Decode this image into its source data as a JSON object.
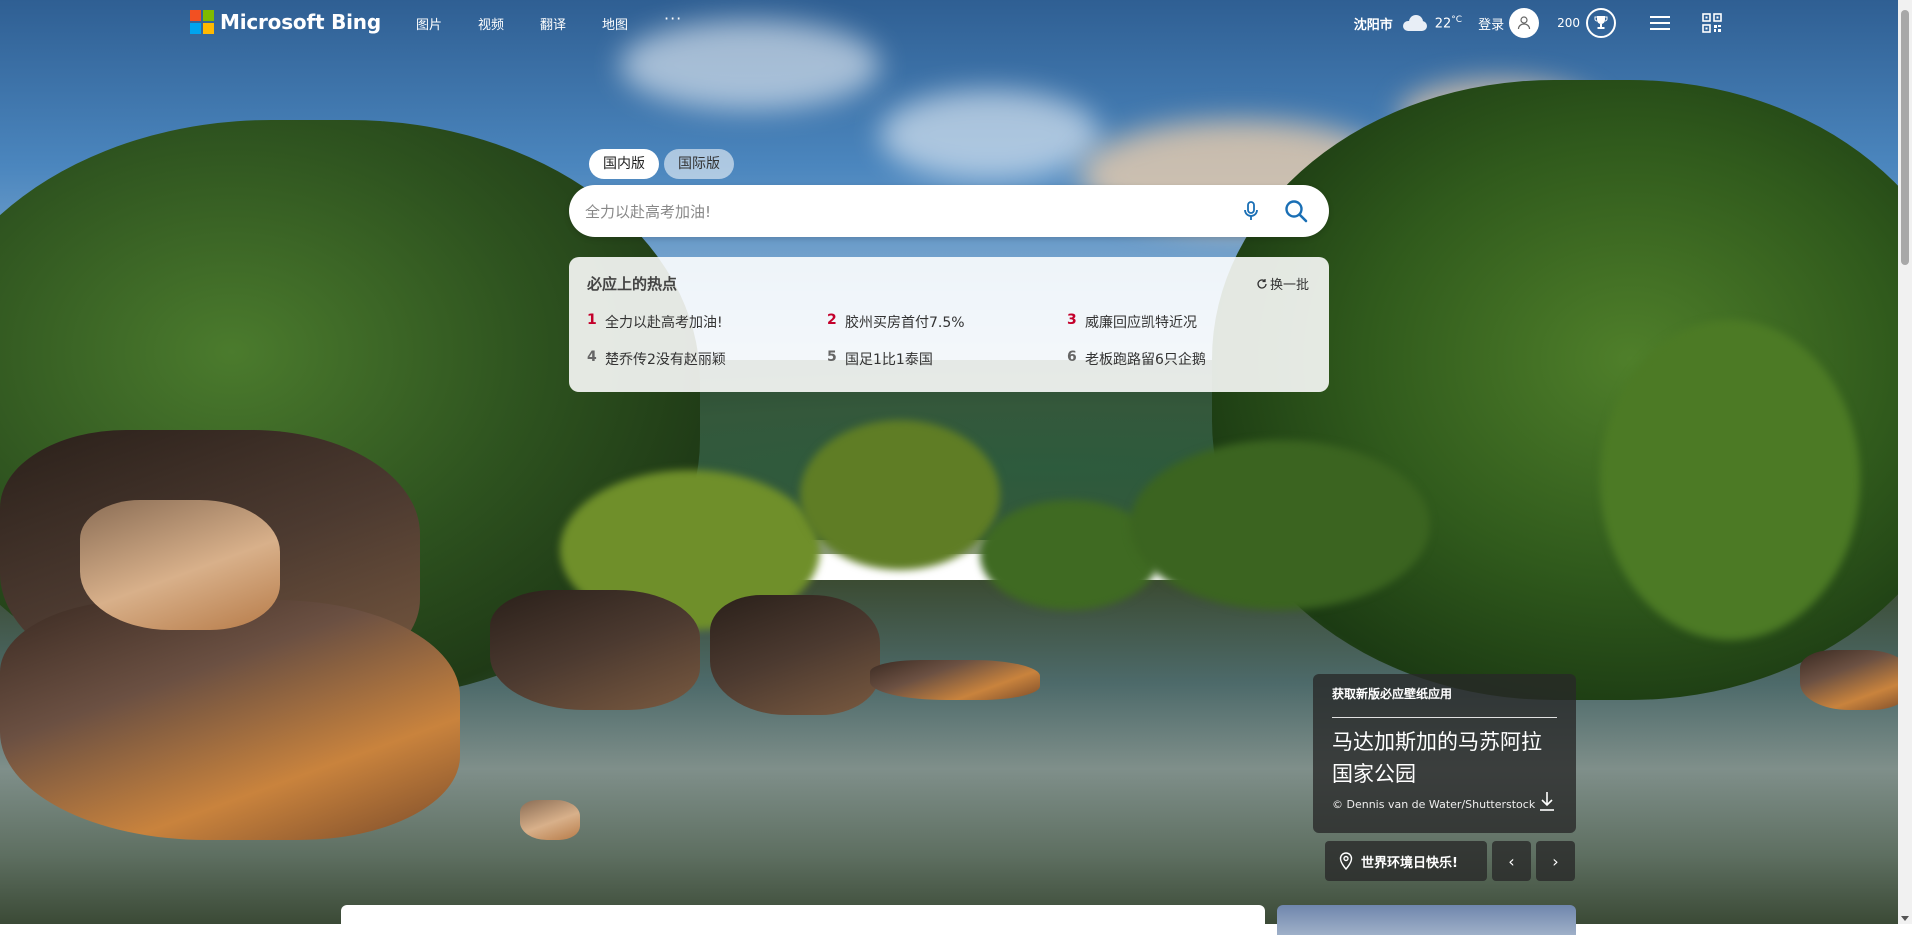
{
  "brand": {
    "logo_text": "Microsoft Bing",
    "logo_colors": [
      "#f25022",
      "#7fba00",
      "#00a4ef",
      "#ffb900"
    ]
  },
  "nav": {
    "items": [
      {
        "label": "图片"
      },
      {
        "label": "视频"
      },
      {
        "label": "翻译"
      },
      {
        "label": "地图"
      }
    ],
    "more_label": "···"
  },
  "header_right": {
    "city": "沈阳市",
    "weather_icon": "cloud-icon",
    "temperature": "22",
    "temperature_unit": "°C",
    "login_label": "登录",
    "points": "200"
  },
  "search": {
    "tabs": [
      {
        "label": "国内版",
        "active": true
      },
      {
        "label": "国际版",
        "active": false
      }
    ],
    "placeholder": "全力以赴高考加油!"
  },
  "trending": {
    "title": "必应上的热点",
    "refresh_label": "换一批",
    "items": [
      {
        "rank": "1",
        "text": "全力以赴高考加油!"
      },
      {
        "rank": "2",
        "text": "胶州买房首付7.5%"
      },
      {
        "rank": "3",
        "text": "威廉回应凯特近况"
      },
      {
        "rank": "4",
        "text": "楚乔传2没有赵丽颖"
      },
      {
        "rank": "5",
        "text": "国足1比1泰国"
      },
      {
        "rank": "6",
        "text": "老板跑路留6只企鹅"
      }
    ],
    "hot_color": "#c4002b"
  },
  "image_info": {
    "promo": "获取新版必应壁纸应用",
    "title": "马达加斯加的马苏阿拉国家公园",
    "copyright": "© Dennis van de Water/Shutterstock"
  },
  "bottom": {
    "quiz_label": "世界环境日快乐!",
    "prev_label": "‹",
    "next_label": "›"
  }
}
